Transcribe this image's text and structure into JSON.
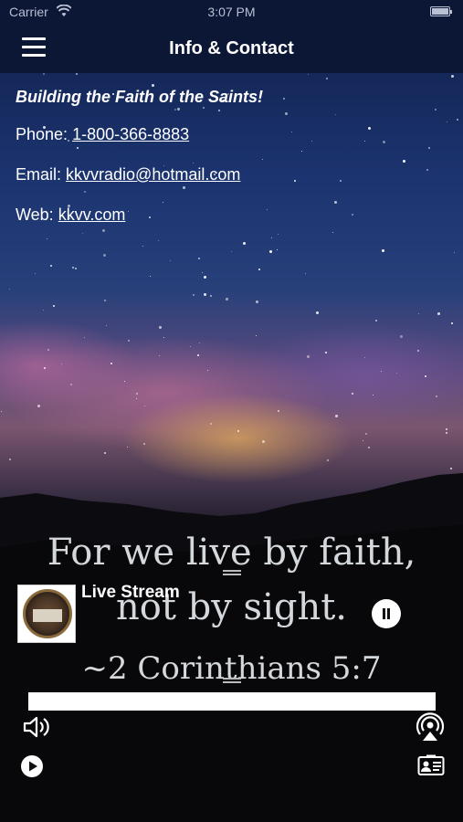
{
  "status_bar": {
    "carrier": "Carrier",
    "time": "3:07 PM"
  },
  "nav": {
    "title": "Info & Contact"
  },
  "info": {
    "tagline": "Building the Faith of the Saints!",
    "phone_label": "Phone: ",
    "phone_value": "1-800-366-8883",
    "email_label": "Email: ",
    "email_value": "kkvvradio@hotmail.com",
    "web_label": "Web: ",
    "web_value": "kkvv.com"
  },
  "verse": {
    "line1": "For we live by faith,",
    "line2": "not by sight.",
    "reference": "~2 Corinthians 5:7"
  },
  "player": {
    "title": "Live Stream",
    "progress": 1.0
  },
  "icons": {
    "menu": "hamburger-menu-icon",
    "pause": "pause-icon",
    "volume": "speaker-volume-icon",
    "airplay": "airplay-icon",
    "play": "play-icon",
    "contact": "contact-card-icon"
  }
}
